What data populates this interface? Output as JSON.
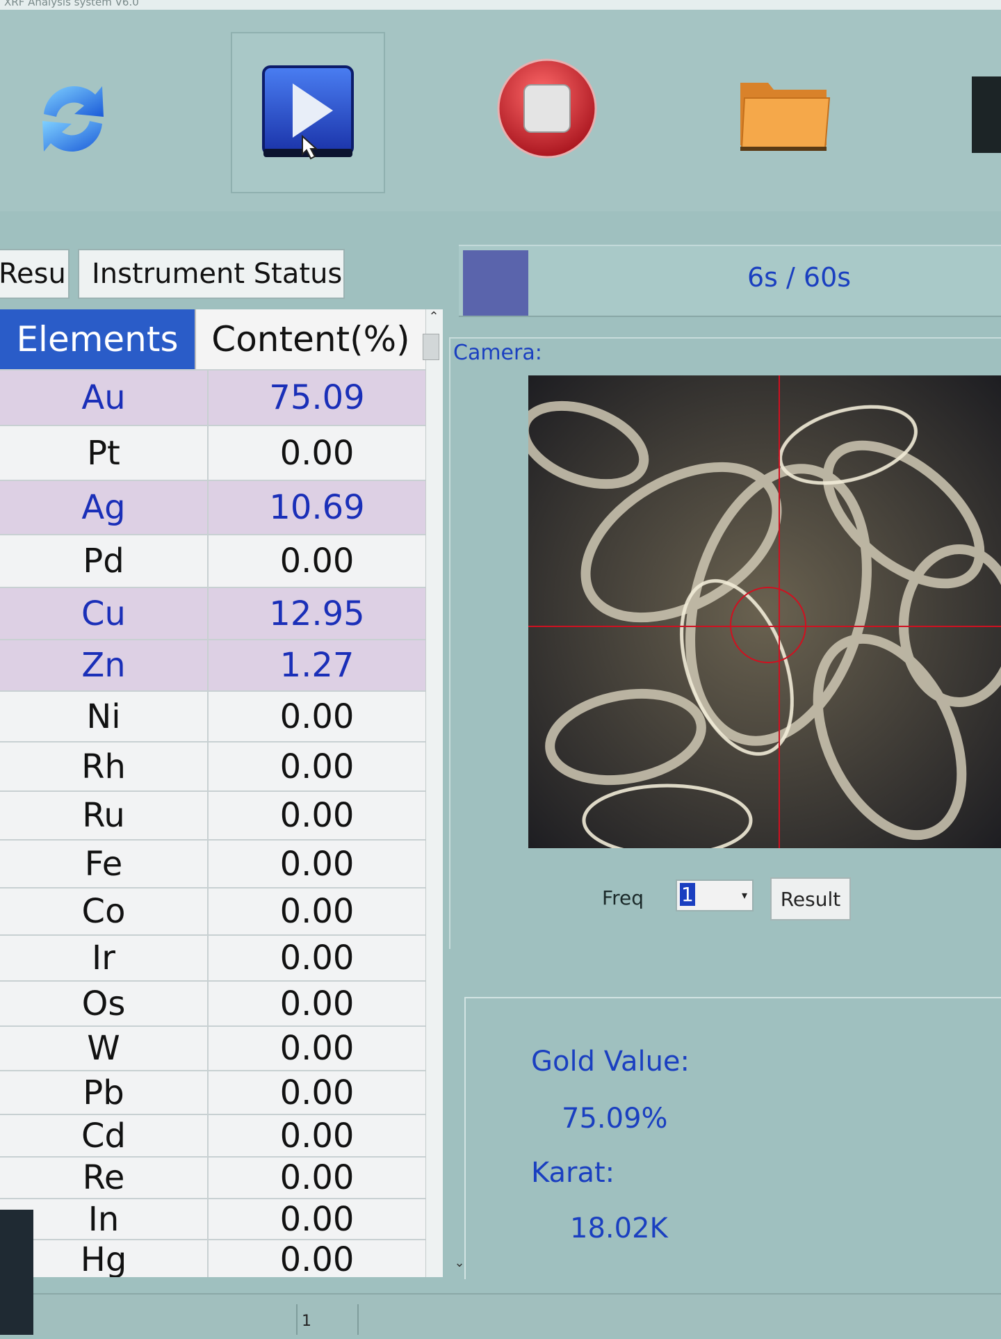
{
  "window": {
    "title": "XRF Analysis system V6.0"
  },
  "toolbar": {
    "refresh_icon": "refresh-icon",
    "start_icon": "play-icon",
    "stop_icon": "stop-icon",
    "open_icon": "folder-icon"
  },
  "tabs": [
    {
      "label": "Result"
    },
    {
      "label": "Instrument Status"
    }
  ],
  "progress": {
    "label": "6s / 60s",
    "elapsed_s": 6,
    "total_s": 60
  },
  "table": {
    "headers": {
      "elements": "Elements",
      "content": "Content(%)"
    },
    "rows": [
      {
        "element": "Au",
        "value": "75.09",
        "highlight": true
      },
      {
        "element": "Pt",
        "value": "0.00",
        "highlight": false
      },
      {
        "element": "Ag",
        "value": "10.69",
        "highlight": true
      },
      {
        "element": "Pd",
        "value": "0.00",
        "highlight": false
      },
      {
        "element": "Cu",
        "value": "12.95",
        "highlight": true
      },
      {
        "element": "Zn",
        "value": "1.27",
        "highlight": true
      },
      {
        "element": "Ni",
        "value": "0.00",
        "highlight": false
      },
      {
        "element": "Rh",
        "value": "0.00",
        "highlight": false
      },
      {
        "element": "Ru",
        "value": "0.00",
        "highlight": false
      },
      {
        "element": "Fe",
        "value": "0.00",
        "highlight": false
      },
      {
        "element": "Co",
        "value": "0.00",
        "highlight": false
      },
      {
        "element": "Ir",
        "value": "0.00",
        "highlight": false
      },
      {
        "element": "Os",
        "value": "0.00",
        "highlight": false
      },
      {
        "element": "W",
        "value": "0.00",
        "highlight": false
      },
      {
        "element": "Pb",
        "value": "0.00",
        "highlight": false
      },
      {
        "element": "Cd",
        "value": "0.00",
        "highlight": false
      },
      {
        "element": "Re",
        "value": "0.00",
        "highlight": false
      },
      {
        "element": "In",
        "value": "0.00",
        "highlight": false
      },
      {
        "element": "Hg",
        "value": "0.00",
        "highlight": false
      }
    ]
  },
  "camera": {
    "label": "Camera:",
    "freq_label": "Freq",
    "freq_value": "1",
    "result_button": "Result"
  },
  "results": {
    "gold_label": "Gold Value:",
    "gold_value": "75.09%",
    "karat_label": "Karat:",
    "karat_value": "18.02K"
  },
  "status_bar": {
    "cell": "1"
  },
  "colors": {
    "background": "#9fc0bf",
    "accent_blue": "#1a3fc0",
    "header_blue": "#2a5cc8",
    "highlight_row": "#ddd0e4",
    "progress_fill": "#5a64ac",
    "crosshair": "#d01020"
  }
}
